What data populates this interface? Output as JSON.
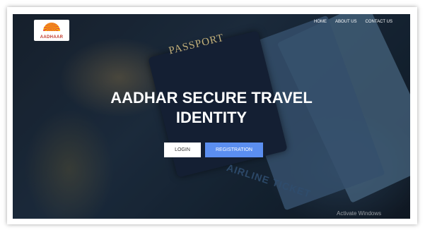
{
  "logo": {
    "text": "AADHAAR"
  },
  "nav": {
    "items": [
      "HOME",
      "ABOUT US",
      "CONTACT US"
    ]
  },
  "hero": {
    "title_line1": "AADHAR SECURE TRAVEL",
    "title_line2": "IDENTITY",
    "passport_text": "PASSPORT",
    "ticket_text": "AIRLINE TICKET"
  },
  "buttons": {
    "login": "LOGIN",
    "registration": "REGISTRATION"
  },
  "watermark": {
    "text": "Activate Windows"
  }
}
